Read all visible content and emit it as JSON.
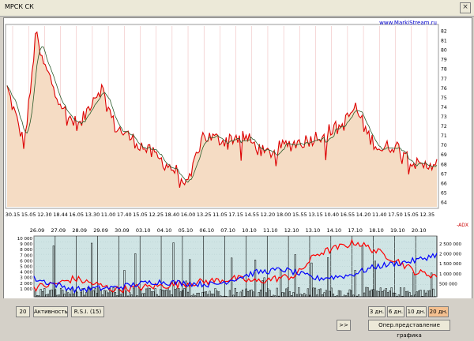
{
  "window": {
    "title": "МРСК СК",
    "close_glyph": "×"
  },
  "chart": {
    "watermark": "www.MarkiStream.ru",
    "price_axis_labels": [
      "82",
      "81",
      "80",
      "79",
      "78",
      "77",
      "76",
      "75",
      "74",
      "73",
      "72",
      "71",
      "70",
      "69",
      "68",
      "67",
      "66",
      "65",
      "64"
    ],
    "time_labels": [
      "30.15",
      "15.05",
      "12.30",
      "18.44",
      "16.05",
      "13.30",
      "11.00",
      "17.40",
      "15.05",
      "12.25",
      "18.40",
      "16.00",
      "13.25",
      "11.05",
      "17.15",
      "14.55",
      "12.20",
      "18.00",
      "15.55",
      "13.15",
      "10.40",
      "16.55",
      "14.20",
      "11.40",
      "17.50",
      "15.05",
      "12.35"
    ],
    "date_labels": [
      "26.09",
      "27.09",
      "28.09",
      "29.09",
      "30.09",
      "03.10",
      "04.10",
      "05.10",
      "06.10",
      "07.10",
      "10.10",
      "11.10",
      "12.10",
      "13.10",
      "14.10",
      "17.10",
      "18.10",
      "19.10",
      "20.10"
    ],
    "vol_left_labels": [
      "10 000",
      "9 000",
      "8 000",
      "7 000",
      "6 000",
      "5 000",
      "4 000",
      "3 000",
      "2 000",
      "1 000"
    ],
    "vol_right_labels": [
      "2 500 000",
      "2 000 000",
      "1 500 000",
      "1 000 000",
      "500 000"
    ],
    "indicator_tag": "-ADX",
    "colors": {
      "price_fill": "#f5dcc4",
      "price_line": "#dd0000",
      "ma_line": "#2a5a2a",
      "series_red": "#ff0000",
      "series_blue": "#0000ff",
      "volume": "#000000",
      "lower_bg": "#cfe4e4",
      "active_button": "#f4c090"
    }
  },
  "toolbar": {
    "period_value": "20",
    "activity_label": "Активность",
    "rsi_label": "R.S.I. (15)",
    "range_3": "3 дн.",
    "range_6": "6 дн.",
    "range_10": "10 дн.",
    "range_20": "20 дн.",
    "forward_label": ">>",
    "view_label": "Опер.представление графика"
  }
}
